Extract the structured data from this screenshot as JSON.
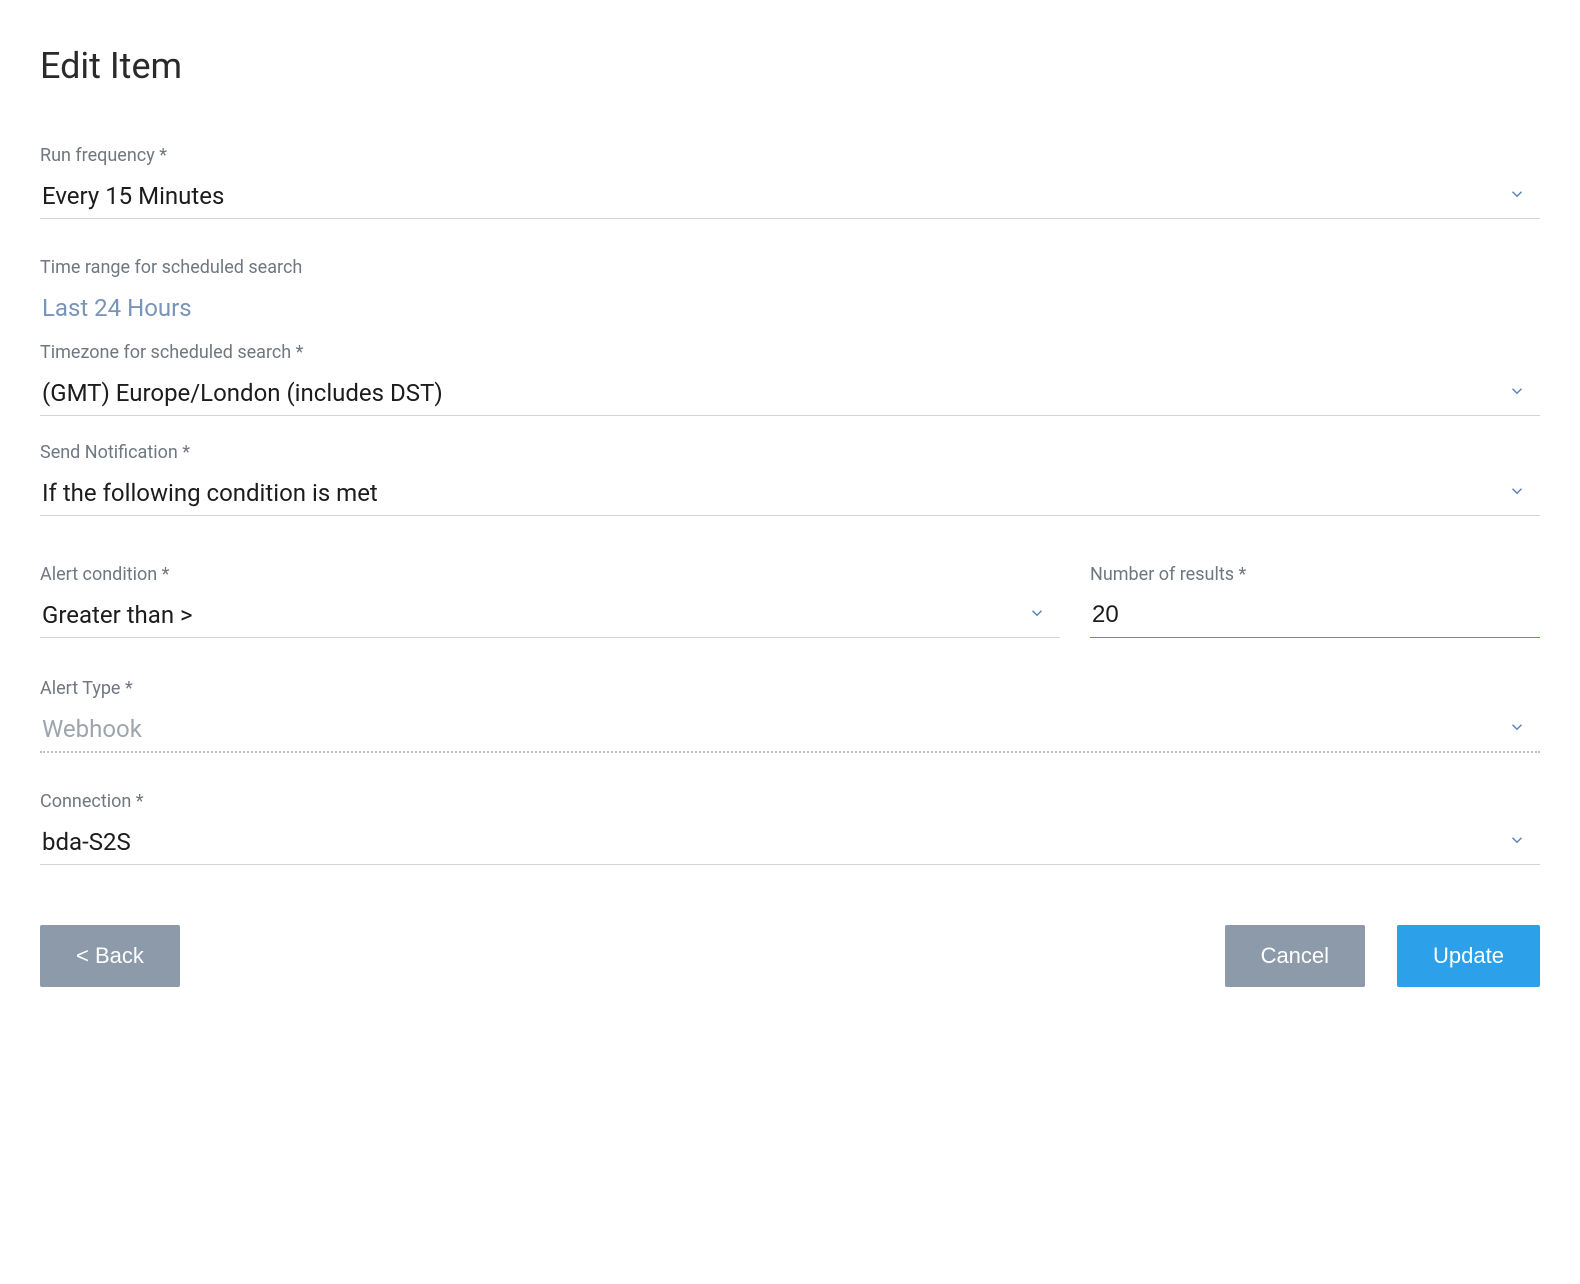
{
  "page_title": "Edit Item",
  "fields": {
    "run_frequency": {
      "label": "Run frequency *",
      "value": "Every 15 Minutes"
    },
    "time_range": {
      "label": "Time range for scheduled search",
      "value": "Last 24 Hours"
    },
    "timezone": {
      "label": "Timezone for scheduled search *",
      "value": "(GMT) Europe/London (includes DST)"
    },
    "send_notification": {
      "label": "Send Notification *",
      "value": "If the following condition is met"
    },
    "alert_condition": {
      "label": "Alert condition *",
      "value": "Greater than >"
    },
    "number_of_results": {
      "label": "Number of results *",
      "value": "20"
    },
    "alert_type": {
      "label": "Alert Type *",
      "value": "Webhook"
    },
    "connection": {
      "label": "Connection *",
      "value": "bda-S2S"
    }
  },
  "buttons": {
    "back": "< Back",
    "cancel": "Cancel",
    "update": "Update"
  }
}
